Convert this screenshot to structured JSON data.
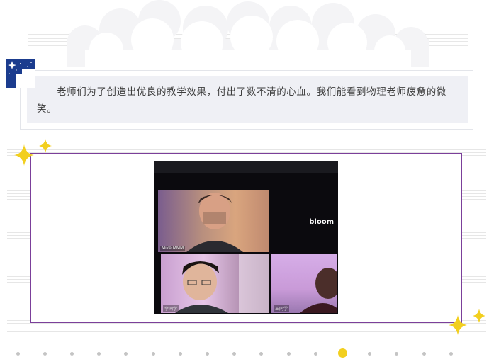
{
  "caption": {
    "text": "老师们为了创造出优良的教学效果，付出了数不清的心血。我们能看到物理老师疲惫的微笑。"
  },
  "meeting": {
    "tiles": [
      {
        "name": "Mike MMM"
      },
      {
        "name": "bloom"
      },
      {
        "name": "李同学"
      },
      {
        "name": "王同学"
      }
    ]
  },
  "pagination": {
    "count": 17,
    "active_index": 12
  },
  "colors": {
    "accent_yellow": "#f2cf1f",
    "frame_purple": "#7b3f9a",
    "caption_bg": "#eff0f5",
    "badge_blue": "#1b3c8e"
  }
}
